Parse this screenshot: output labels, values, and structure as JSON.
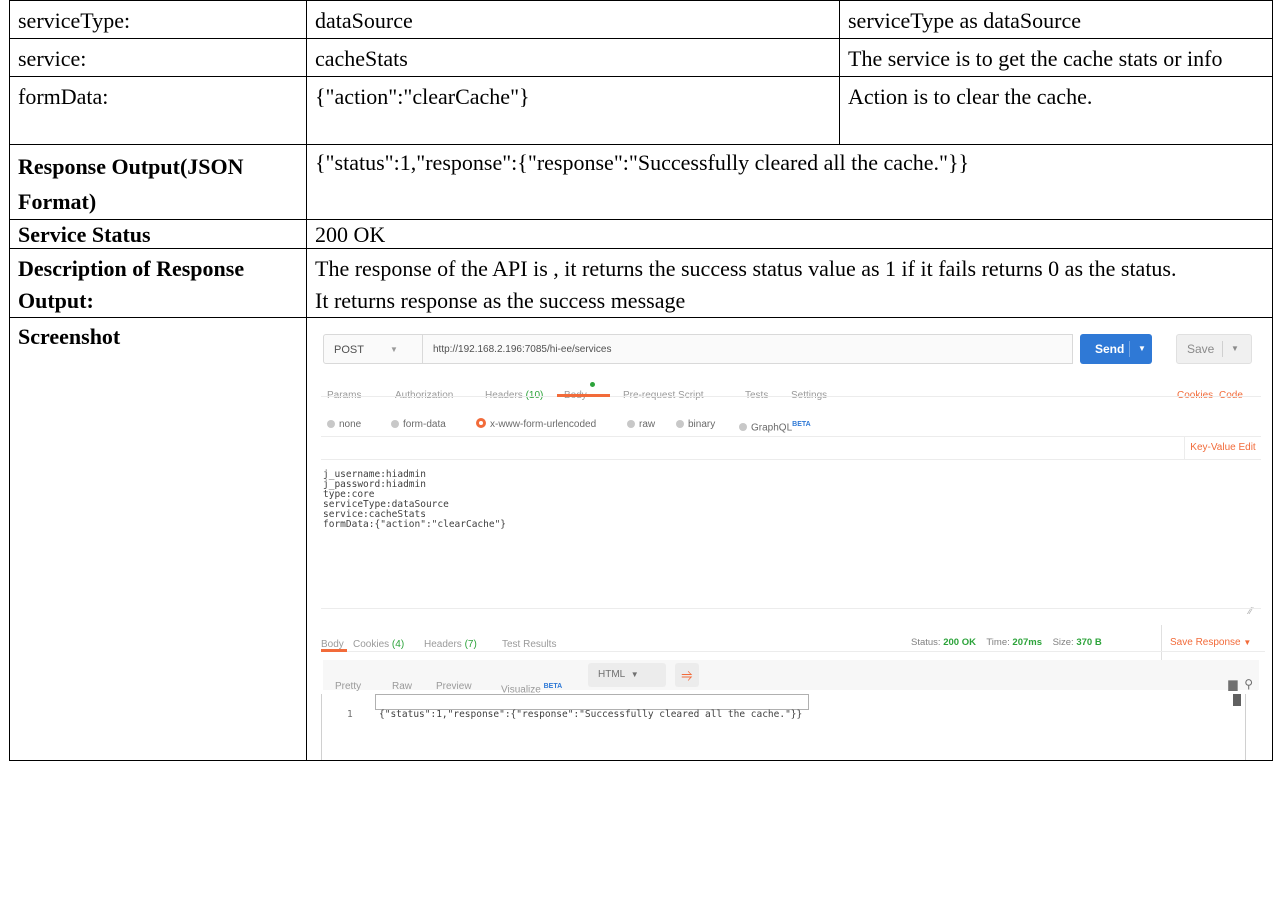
{
  "rows": [
    {
      "label": "serviceType:",
      "value": "dataSource",
      "desc": "serviceType as dataSource"
    },
    {
      "label": "service:",
      "value": "cacheStats",
      "desc": "The service is to get the cache stats or info"
    },
    {
      "label": "formData:",
      "value": "{\"action\":\"clearCache\"}",
      "desc": "Action is to clear the cache."
    }
  ],
  "response_output": {
    "label": "Response Output(JSON Format)",
    "value": "{\"status\":1,\"response\":{\"response\":\"Successfully cleared all the cache.\"}}"
  },
  "service_status": {
    "label": "Service Status",
    "value": "200 OK"
  },
  "description": {
    "label": "Description of Response Output:",
    "line1": "The response of the API is , it returns the success status value as 1 if it fails returns 0 as the status.",
    "line2": "It returns response as the success message"
  },
  "screenshot": {
    "label": "Screenshot"
  },
  "postman": {
    "method": "POST",
    "url": "http://192.168.2.196:7085/hi-ee/services",
    "send": "Send",
    "save": "Save",
    "tabs": {
      "params": "Params",
      "authorization": "Authorization",
      "headers": "Headers",
      "headers_count": "(10)",
      "body": "Body",
      "prerequest": "Pre-request Script",
      "tests": "Tests",
      "settings": "Settings",
      "cookies": "Cookies",
      "code": "Code"
    },
    "body_types": {
      "none": "none",
      "formdata": "form-data",
      "urlencoded": "x-www-form-urlencoded",
      "raw": "raw",
      "binary": "binary",
      "graphql": "GraphQL",
      "beta": "BETA"
    },
    "key_value_edit": "Key-Value Edit",
    "body_lines": "j_username:hiadmin\nj_password:hiadmin\ntype:core\nserviceType:dataSource\nservice:cacheStats\nformData:{\"action\":\"clearCache\"}",
    "response_tabs": {
      "body": "Body",
      "cookies": "Cookies",
      "cookies_count": "(4)",
      "headers": "Headers",
      "headers_count": "(7)",
      "test_results": "Test Results"
    },
    "status": {
      "status_label": "Status:",
      "status_value": "200 OK",
      "time_label": "Time:",
      "time_value": "207ms",
      "size_label": "Size:",
      "size_value": "370 B"
    },
    "save_response": "Save Response",
    "view": {
      "pretty": "Pretty",
      "raw": "Raw",
      "preview": "Preview",
      "visualize": "Visualize",
      "beta": "BETA",
      "format": "HTML"
    },
    "response_line_number": "1",
    "response_text": "{\"status\":1,\"response\":{\"response\":\"Successfully cleared all the cache.\"}}"
  }
}
